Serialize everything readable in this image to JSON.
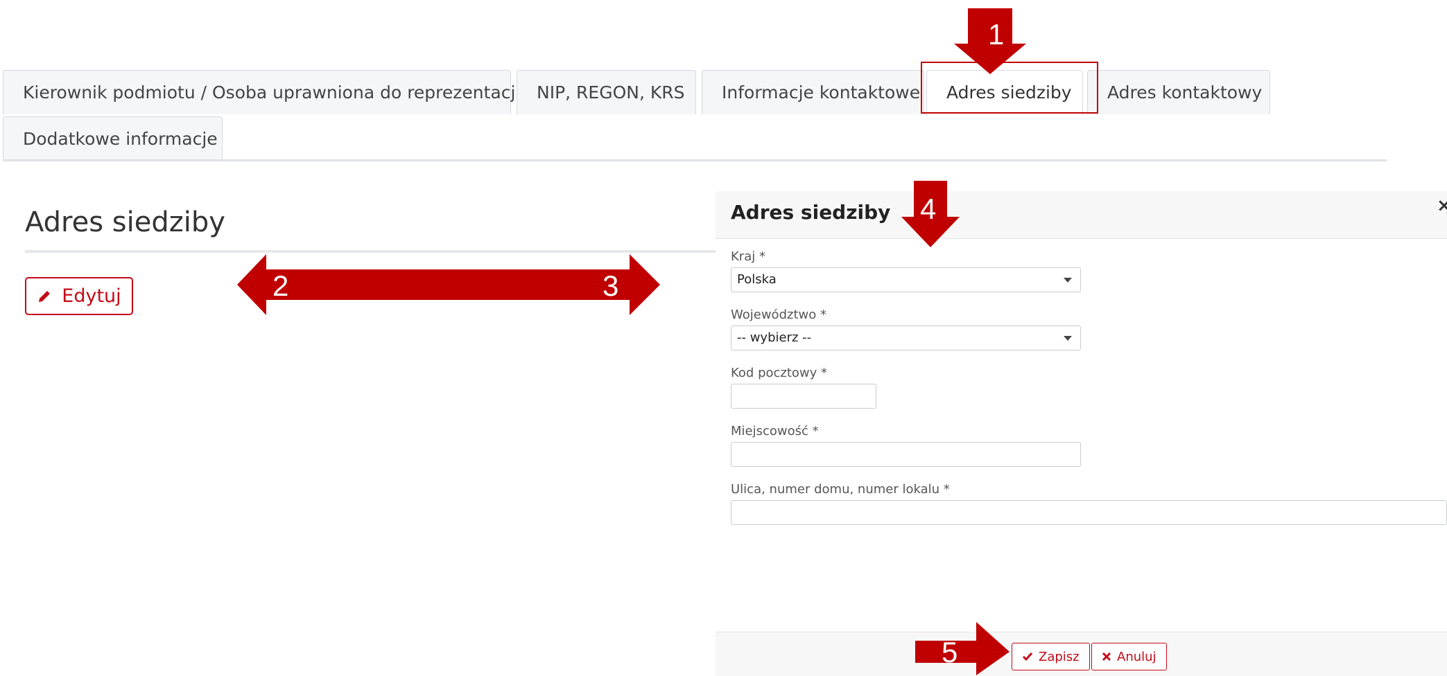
{
  "tabs": [
    {
      "label": "Kierownik podmiotu / Osoba uprawniona do reprezentacji",
      "active": false
    },
    {
      "label": "NIP, REGON, KRS",
      "active": false
    },
    {
      "label": "Informacje kontaktowe",
      "active": false
    },
    {
      "label": "Adres siedziby",
      "active": true
    },
    {
      "label": "Adres kontaktowy",
      "active": false
    },
    {
      "label": "Dodatkowe informacje",
      "active": false
    }
  ],
  "section": {
    "title": "Adres siedziby",
    "edit_label": "Edytuj",
    "edit_icon": "pencil-icon"
  },
  "modal": {
    "title": "Adres siedziby",
    "close_symbol": "×",
    "fields": {
      "country": {
        "label": "Kraj *",
        "value": "Polska"
      },
      "voivodeship": {
        "label": "Województwo *",
        "value": "-- wybierz --"
      },
      "postal_code": {
        "label": "Kod pocztowy *",
        "value": ""
      },
      "city": {
        "label": "Miejscowość *",
        "value": ""
      },
      "street": {
        "label": "Ulica, numer domu, numer lokalu *",
        "value": ""
      }
    },
    "save_label": "Zapisz",
    "cancel_label": "Anuluj",
    "save_icon": "check-icon",
    "cancel_icon": "x-icon"
  },
  "annotations": {
    "color": "#c00000",
    "numbers": [
      "1",
      "2",
      "3",
      "4",
      "5"
    ]
  },
  "colors": {
    "accent": "#c30a16",
    "tab_bg": "#f4f6f8"
  }
}
